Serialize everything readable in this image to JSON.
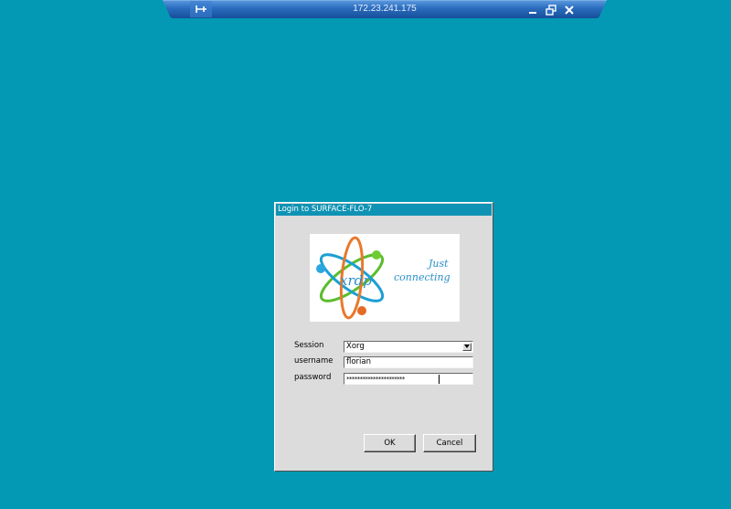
{
  "rdp_bar": {
    "title": "172.23.241.175",
    "icons": {
      "pin": "pin-icon",
      "minimize": "minimize-icon",
      "restore": "restore-icon",
      "close": "close-icon"
    },
    "colors": {
      "bar": "#1d5fae",
      "bar_highlight": "#5d9be0"
    }
  },
  "desktop": {
    "background_color": "#0399b5"
  },
  "login_dialog": {
    "title": "Login to SURFACE-FLO-7",
    "logo": {
      "brand": "xrdp",
      "tagline_line1": "Just",
      "tagline_line2": "connecting"
    },
    "fields": {
      "session": {
        "label": "Session",
        "value": "Xorg"
      },
      "username": {
        "label": "username",
        "value": "florian"
      },
      "password": {
        "label": "password",
        "value": "**********************"
      }
    },
    "buttons": {
      "ok": "OK",
      "cancel": "Cancel"
    },
    "colors": {
      "titlebar": "#0f93b4",
      "body": "#dcdcdc"
    }
  }
}
